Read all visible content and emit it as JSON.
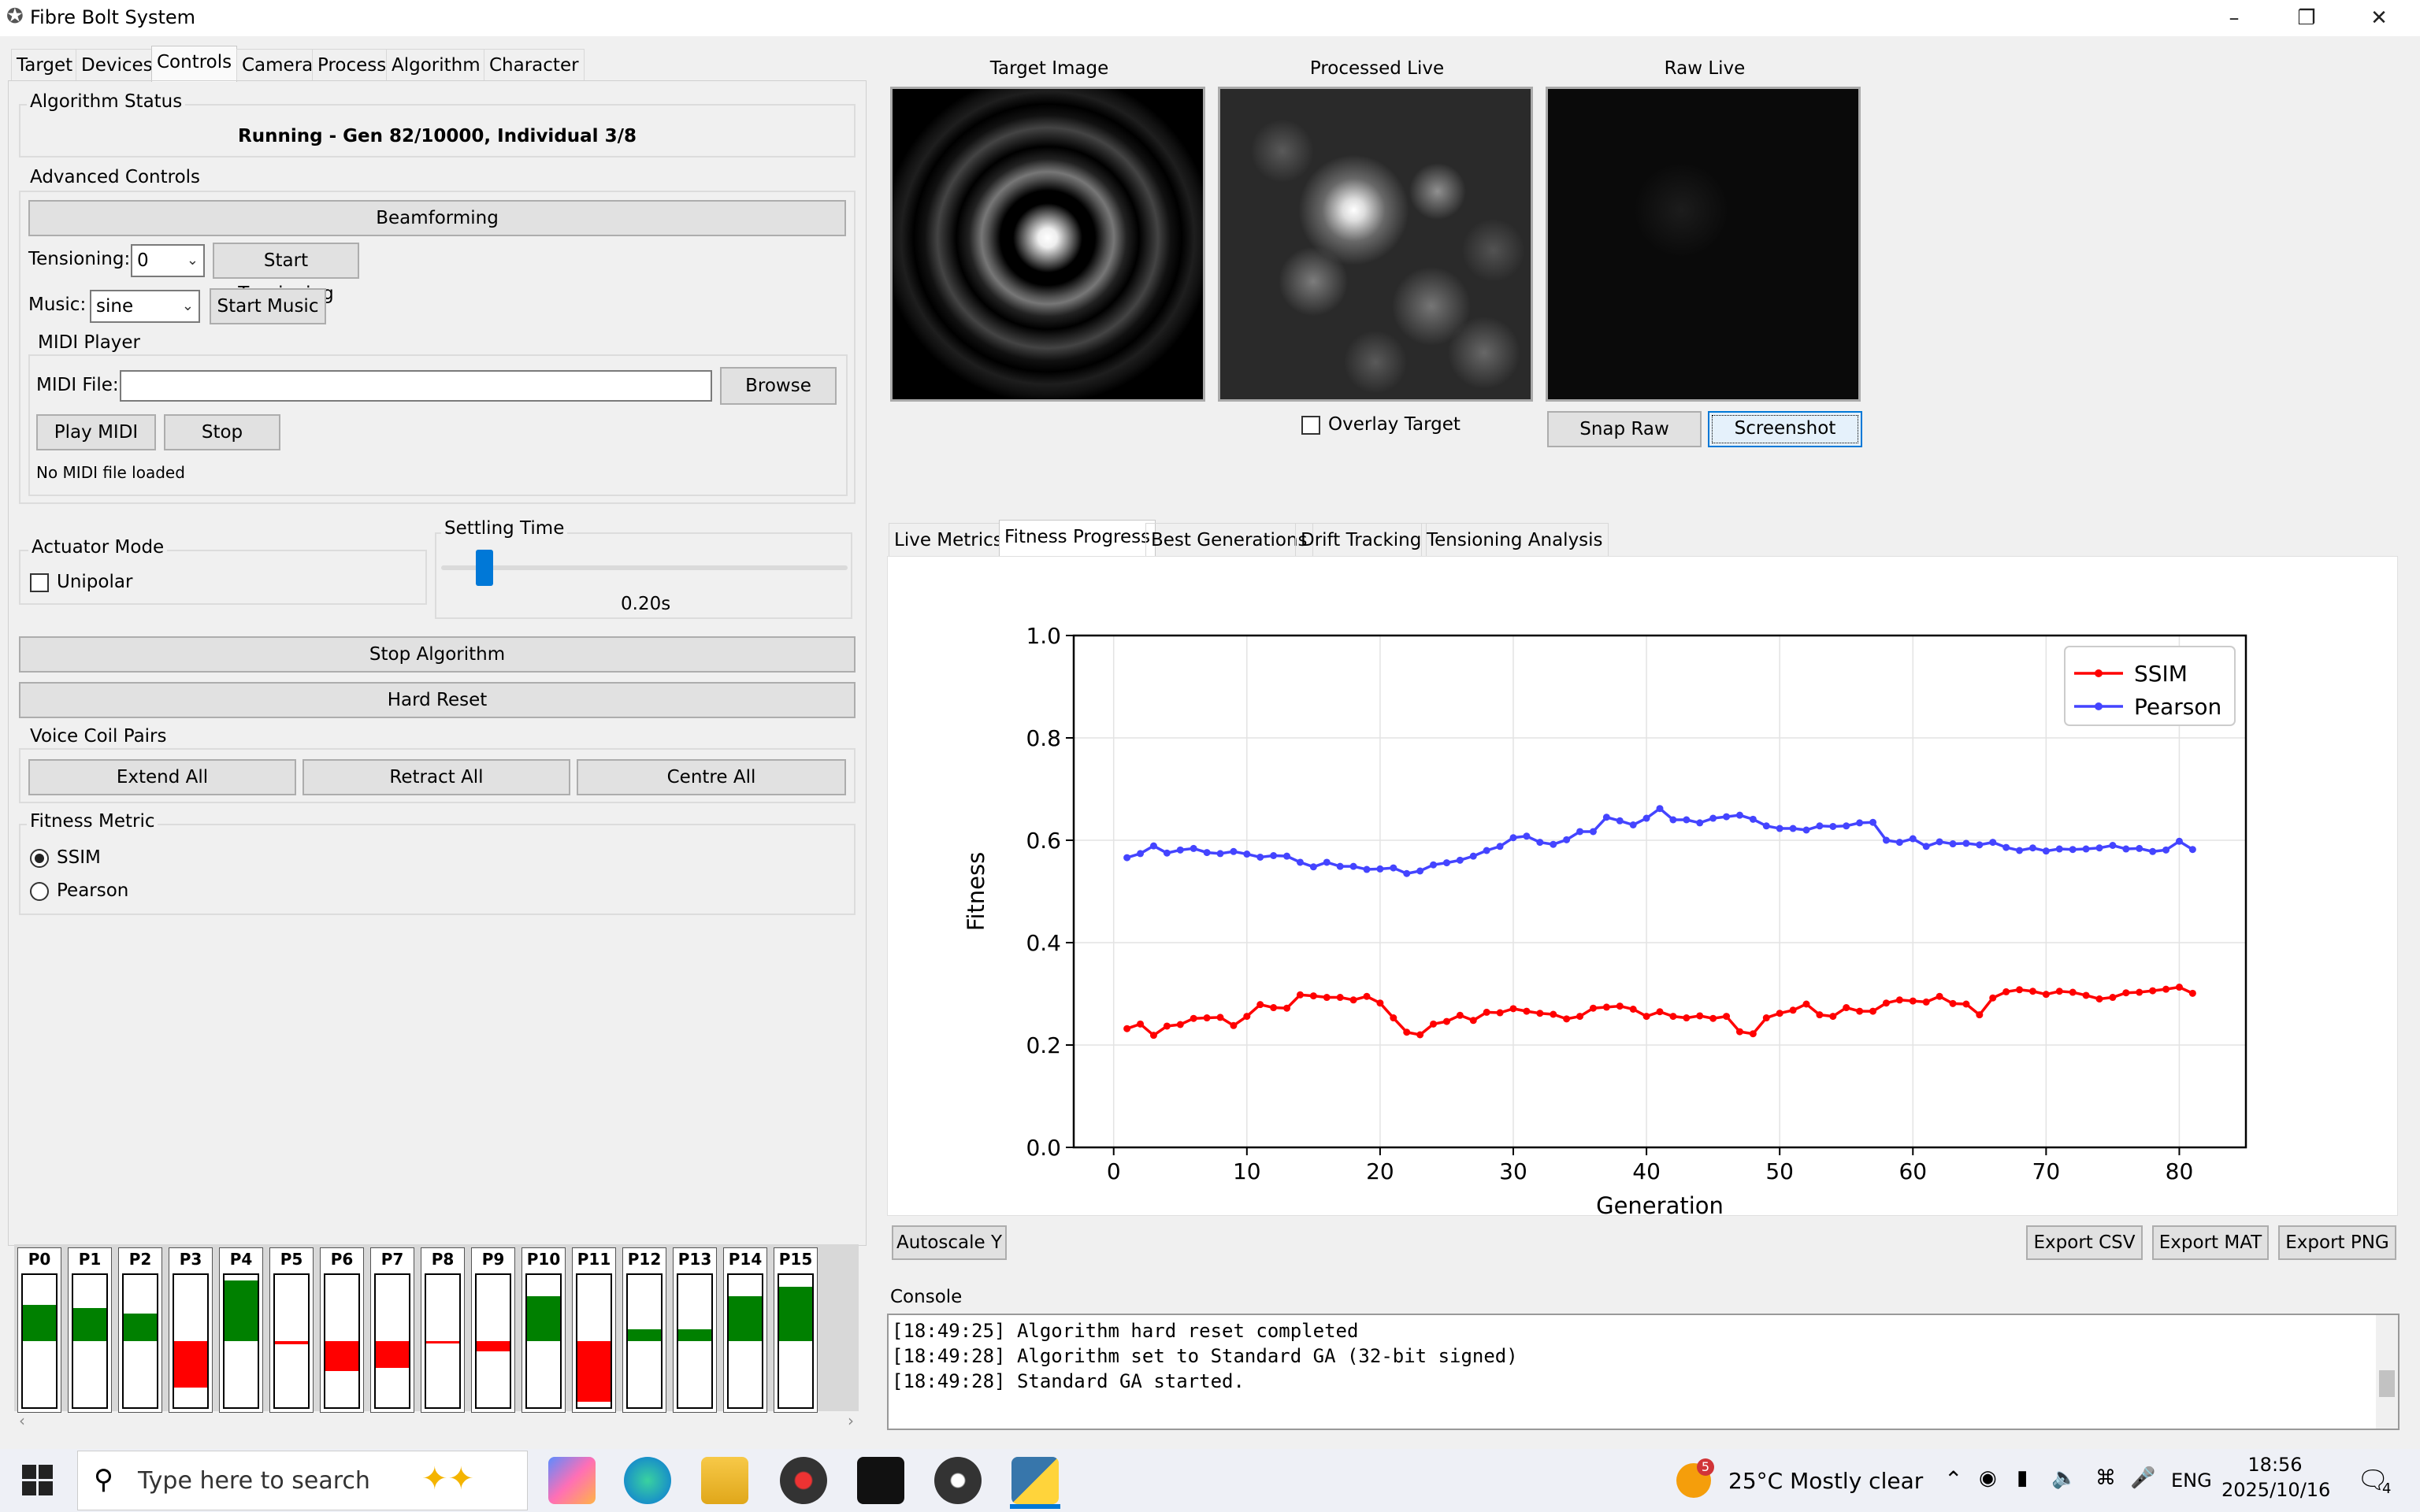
{
  "window": {
    "title": "Fibre Bolt System"
  },
  "tabs": [
    "Target",
    "Devices",
    "Controls",
    "Camera",
    "Process",
    "Algorithm",
    "Character"
  ],
  "status": {
    "group": "Algorithm Status",
    "text": "Running - Gen 82/10000, Individual 3/8"
  },
  "advanced": {
    "group": "Advanced Controls",
    "beamforming": "Beamforming",
    "tensioning_label": "Tensioning:",
    "tensioning_value": "0",
    "start_tensioning": "Start Tensioning",
    "music_label": "Music:",
    "music_value": "sine",
    "start_music": "Start Music"
  },
  "midi": {
    "group": "MIDI Player",
    "file_label": "MIDI File:",
    "file_value": "",
    "browse": "Browse",
    "play": "Play MIDI",
    "stop": "Stop",
    "status": "No MIDI file loaded"
  },
  "actuator": {
    "group": "Actuator Mode",
    "unipolar": "Unipolar",
    "unipolar_checked": false
  },
  "settling": {
    "group": "Settling Time",
    "value": "0.20s",
    "slider_fraction": 0.1
  },
  "stop_algorithm": "Stop Algorithm",
  "hard_reset": "Hard Reset",
  "coils": {
    "group": "Voice Coil Pairs",
    "extend": "Extend All",
    "retract": "Retract All",
    "centre": "Centre All"
  },
  "fitness_metric": {
    "group": "Fitness Metric",
    "options": [
      "SSIM",
      "Pearson"
    ],
    "selected": "SSIM"
  },
  "pairs": [
    {
      "label": "P0",
      "value": 0.55
    },
    {
      "label": "P1",
      "value": 0.5
    },
    {
      "label": "P2",
      "value": 0.42
    },
    {
      "label": "P3",
      "value": -0.7
    },
    {
      "label": "P4",
      "value": 0.92
    },
    {
      "label": "P5",
      "value": -0.05
    },
    {
      "label": "P6",
      "value": -0.45
    },
    {
      "label": "P7",
      "value": -0.4
    },
    {
      "label": "P8",
      "value": -0.02
    },
    {
      "label": "P9",
      "value": -0.16
    },
    {
      "label": "P10",
      "value": 0.68
    },
    {
      "label": "P11",
      "value": -0.92
    },
    {
      "label": "P12",
      "value": 0.18
    },
    {
      "label": "P13",
      "value": 0.18
    },
    {
      "label": "P14",
      "value": 0.68
    },
    {
      "label": "P15",
      "value": 0.82
    }
  ],
  "images": {
    "target": "Target Image",
    "processed": "Processed Live",
    "raw": "Raw Live",
    "overlay": "Overlay Target",
    "snap": "Snap Raw",
    "screenshot": "Screenshot"
  },
  "plot_tabs": [
    "Live Metrics",
    "Fitness Progress",
    "Best Generations",
    "Drift Tracking",
    "Tensioning Analysis"
  ],
  "plot_buttons": {
    "autoscale": "Autoscale Y",
    "csv": "Export CSV",
    "mat": "Export MAT",
    "png": "Export PNG"
  },
  "console": {
    "title": "Console",
    "lines": [
      "[18:49:25] Algorithm hard reset completed",
      "[18:49:28] Algorithm set to Standard GA (32-bit signed)",
      "[18:49:28] Standard GA started."
    ]
  },
  "taskbar": {
    "search": "Type here to search",
    "weather": "25°C  Mostly clear",
    "lang": "ENG",
    "time": "18:56",
    "date": "2025/10/16",
    "notif": "4",
    "weather_badge": "5"
  },
  "chart_data": {
    "type": "line",
    "xlabel": "Generation",
    "ylabel": "Fitness",
    "xlim": [
      -3,
      85
    ],
    "ylim": [
      0,
      1
    ],
    "xticks": [
      0,
      10,
      20,
      30,
      40,
      50,
      60,
      70,
      80
    ],
    "yticks": [
      0.0,
      0.2,
      0.4,
      0.6,
      0.8,
      1.0
    ],
    "grid": true,
    "legend": "top-right",
    "x": [
      1,
      2,
      3,
      4,
      5,
      6,
      7,
      8,
      9,
      10,
      11,
      12,
      13,
      14,
      15,
      16,
      17,
      18,
      19,
      20,
      21,
      22,
      23,
      24,
      25,
      26,
      27,
      28,
      29,
      30,
      31,
      32,
      33,
      34,
      35,
      36,
      37,
      38,
      39,
      40,
      41,
      42,
      43,
      44,
      45,
      46,
      47,
      48,
      49,
      50,
      51,
      52,
      53,
      54,
      55,
      56,
      57,
      58,
      59,
      60,
      61,
      62,
      63,
      64,
      65,
      66,
      67,
      68,
      69,
      70,
      71,
      72,
      73,
      74,
      75,
      76,
      77,
      78,
      79,
      80,
      81
    ],
    "series": [
      {
        "name": "SSIM",
        "color": "#ff0000",
        "values": [
          0.232,
          0.241,
          0.219,
          0.237,
          0.24,
          0.252,
          0.253,
          0.254,
          0.238,
          0.256,
          0.279,
          0.273,
          0.272,
          0.298,
          0.296,
          0.293,
          0.293,
          0.288,
          0.295,
          0.282,
          0.253,
          0.225,
          0.22,
          0.241,
          0.246,
          0.258,
          0.248,
          0.264,
          0.263,
          0.271,
          0.266,
          0.262,
          0.26,
          0.251,
          0.256,
          0.272,
          0.274,
          0.276,
          0.27,
          0.256,
          0.265,
          0.256,
          0.253,
          0.257,
          0.252,
          0.256,
          0.226,
          0.222,
          0.253,
          0.262,
          0.268,
          0.28,
          0.259,
          0.256,
          0.273,
          0.266,
          0.266,
          0.282,
          0.288,
          0.286,
          0.284,
          0.295,
          0.281,
          0.28,
          0.259,
          0.292,
          0.304,
          0.308,
          0.305,
          0.299,
          0.305,
          0.303,
          0.297,
          0.29,
          0.293,
          0.302,
          0.303,
          0.306,
          0.309,
          0.313,
          0.301
        ]
      },
      {
        "name": "Pearson",
        "color": "#4444ff",
        "values": [
          0.566,
          0.574,
          0.589,
          0.575,
          0.581,
          0.584,
          0.576,
          0.574,
          0.578,
          0.573,
          0.567,
          0.57,
          0.569,
          0.557,
          0.548,
          0.557,
          0.549,
          0.549,
          0.543,
          0.544,
          0.546,
          0.535,
          0.54,
          0.552,
          0.556,
          0.561,
          0.569,
          0.58,
          0.588,
          0.605,
          0.608,
          0.596,
          0.592,
          0.601,
          0.617,
          0.617,
          0.645,
          0.638,
          0.63,
          0.643,
          0.662,
          0.64,
          0.64,
          0.634,
          0.643,
          0.646,
          0.649,
          0.641,
          0.628,
          0.623,
          0.623,
          0.62,
          0.628,
          0.627,
          0.628,
          0.634,
          0.635,
          0.6,
          0.596,
          0.603,
          0.588,
          0.597,
          0.593,
          0.594,
          0.591,
          0.596,
          0.586,
          0.58,
          0.585,
          0.579,
          0.583,
          0.582,
          0.583,
          0.585,
          0.59,
          0.583,
          0.584,
          0.578,
          0.581,
          0.598,
          0.582
        ]
      }
    ]
  }
}
